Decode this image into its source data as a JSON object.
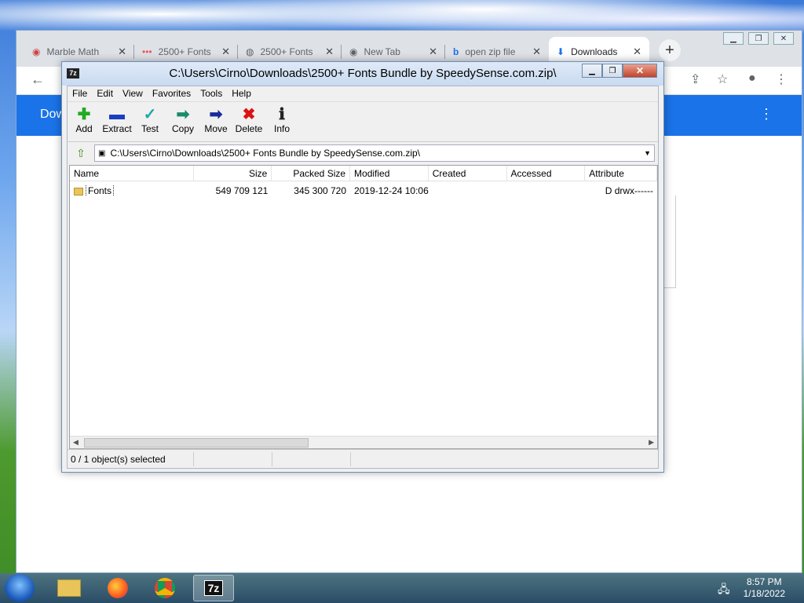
{
  "chrome": {
    "tabs": [
      {
        "label": "Marble Math",
        "icon": "marble-icon"
      },
      {
        "label": "2500+ Fonts",
        "icon": "dots-icon"
      },
      {
        "label": "2500+ Fonts",
        "icon": "globe-icon"
      },
      {
        "label": "New Tab",
        "icon": "chrome-icon"
      },
      {
        "label": "open zip file",
        "icon": "bing-icon"
      },
      {
        "label": "Downloads",
        "icon": "download-icon"
      }
    ],
    "new_tab": "+",
    "page_header": "Dow",
    "menu": "⋮"
  },
  "zip": {
    "title": "C:\\Users\\Cirno\\Downloads\\2500+ Fonts Bundle by SpeedySense.com.zip\\",
    "app_icon": "7z",
    "menu": [
      "File",
      "Edit",
      "View",
      "Favorites",
      "Tools",
      "Help"
    ],
    "toolbar": [
      {
        "label": "Add",
        "icon": "plus-icon",
        "glyph": "✚",
        "color": "#22aa22"
      },
      {
        "label": "Extract",
        "icon": "minus-icon",
        "glyph": "▬",
        "color": "#1a3fbf"
      },
      {
        "label": "Test",
        "icon": "check-icon",
        "glyph": "✓",
        "color": "#1aa9a9"
      },
      {
        "label": "Copy",
        "icon": "copy-arrow-icon",
        "glyph": "➡",
        "color": "#1a8a6a"
      },
      {
        "label": "Move",
        "icon": "move-arrow-icon",
        "glyph": "➡",
        "color": "#1a2a9a"
      },
      {
        "label": "Delete",
        "icon": "delete-x-icon",
        "glyph": "✖",
        "color": "#dd1111"
      },
      {
        "label": "Info",
        "icon": "info-icon",
        "glyph": "ℹ",
        "color": "#222"
      }
    ],
    "address": "C:\\Users\\Cirno\\Downloads\\2500+ Fonts Bundle by SpeedySense.com.zip\\",
    "columns": [
      "Name",
      "Size",
      "Packed Size",
      "Modified",
      "Created",
      "Accessed",
      "Attribute"
    ],
    "rows": [
      {
        "name": "Fonts",
        "size": "549 709 121",
        "packed": "345 300 720",
        "modified": "2019-12-24 10:06",
        "created": "",
        "accessed": "",
        "attr": "D drwx------"
      }
    ],
    "status": "0 / 1 object(s) selected"
  },
  "taskbar": {
    "time": "8:57 PM",
    "date": "1/18/2022",
    "active_app": "7z"
  }
}
